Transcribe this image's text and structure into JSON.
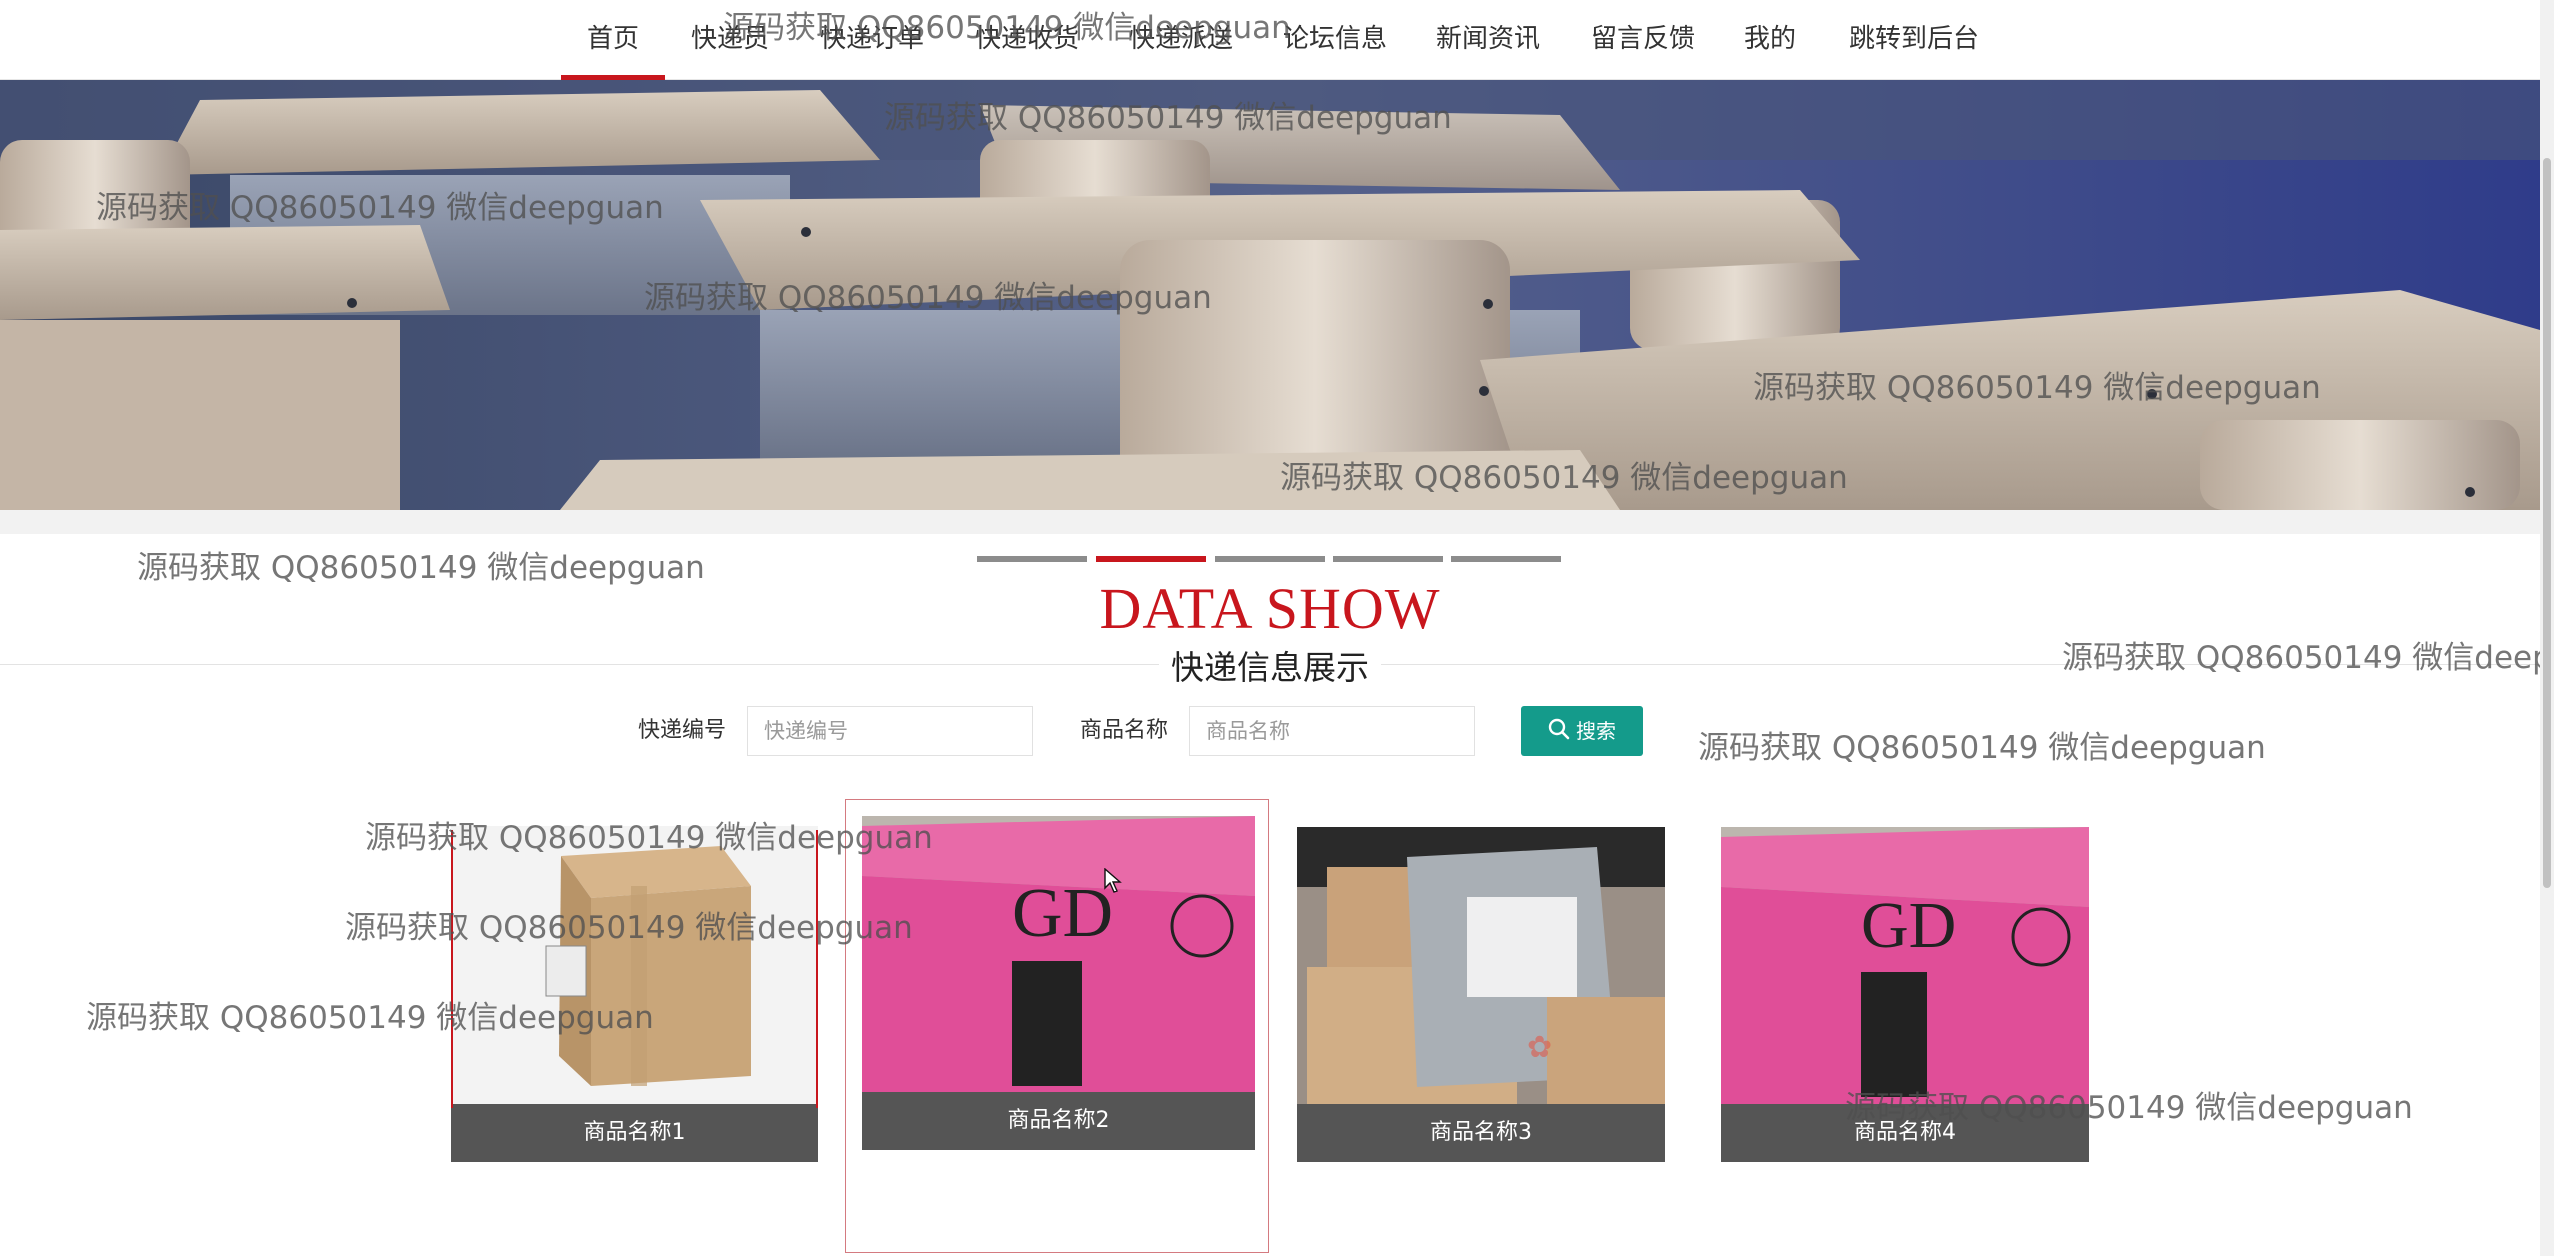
{
  "nav": {
    "items": [
      "首页",
      "快递员",
      "快递订单",
      "快递收货",
      "快递派送",
      "论坛信息",
      "新闻资讯",
      "留言反馈",
      "我的",
      "跳转到后台"
    ],
    "active_index": 0,
    "accent_color": "#c8161d"
  },
  "banner": {
    "image": "classroom-desks-illustration",
    "slide_count": 5,
    "active_slide": 2
  },
  "section": {
    "title_en": "DATA SHOW",
    "title_cn": "快递信息展示"
  },
  "search": {
    "field1_label": "快递编号",
    "field1_placeholder": "快递编号",
    "field2_label": "商品名称",
    "field2_placeholder": "商品名称",
    "button_label": "搜索",
    "button_icon": "search-icon",
    "button_color": "#149b8b"
  },
  "products": [
    {
      "name": "商品名称1",
      "image": "cardboard-box"
    },
    {
      "name": "商品名称2",
      "image": "pink-box"
    },
    {
      "name": "商品名称3",
      "image": "parcels-pile"
    },
    {
      "name": "商品名称4",
      "image": "pink-box"
    }
  ],
  "watermark": "源码获取 QQ86050149 微信deepguan"
}
